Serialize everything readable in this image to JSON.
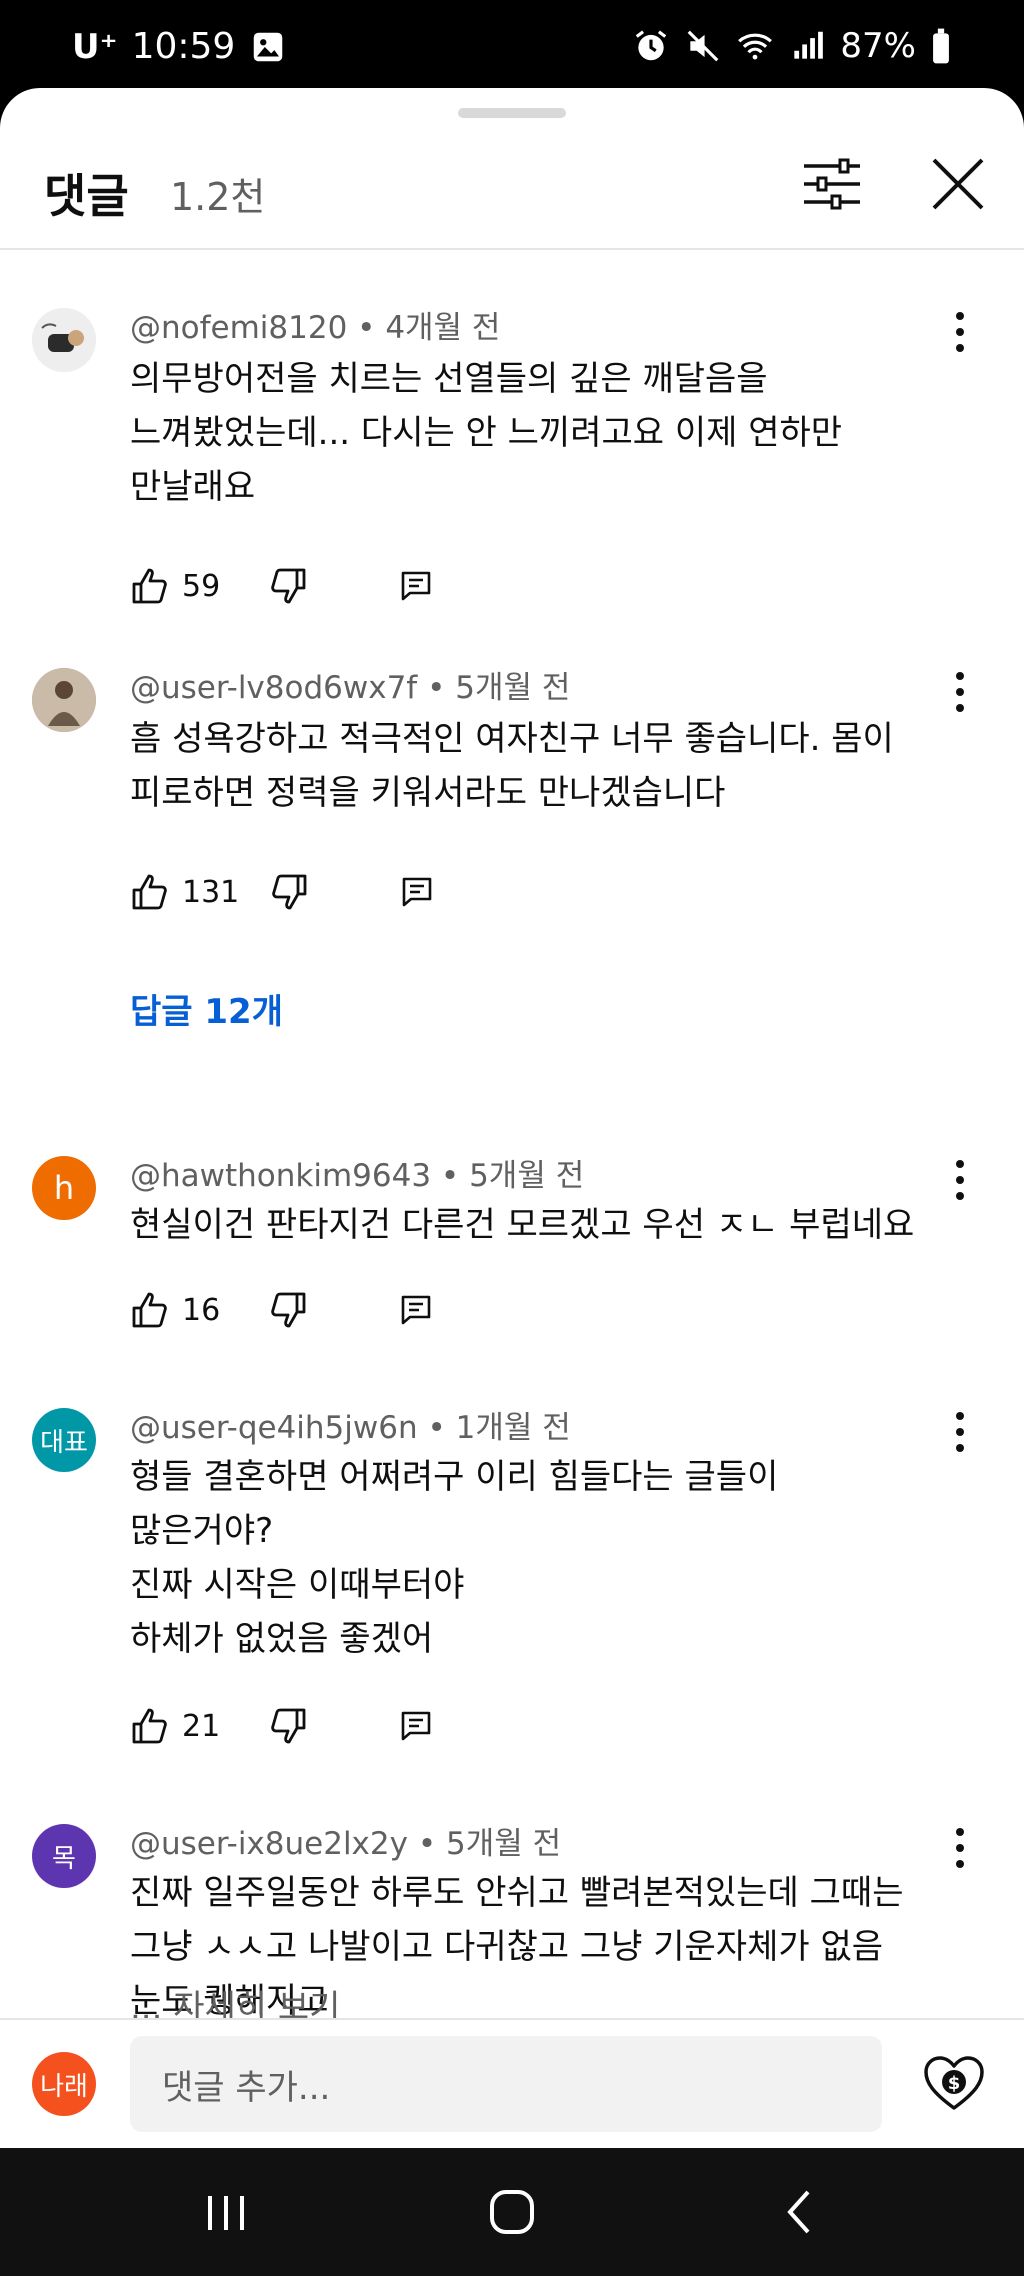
{
  "status_bar": {
    "carrier": "U⁺",
    "time": "10:59",
    "battery": "87%"
  },
  "header": {
    "title": "댓글",
    "count": "1.2천"
  },
  "comments": [
    {
      "author": "@nofemi8120",
      "age": "4개월 전",
      "text": "의무방어전을 치르는 선열들의 깊은 깨달음을\n느껴봤었는데... 다시는 안 느끼려고요 이제 연하만\n만날래요",
      "likes": "59",
      "avatar_color": "#e0e0e0"
    },
    {
      "author": "@user-lv8od6wx7f",
      "age": "5개월 전",
      "text": "흠 성욕강하고 적극적인 여자친구 너무 좋습니다. 몸이\n피로하면 정력을 키워서라도 만나겠습니다",
      "likes": "131",
      "replies": "답글 12개",
      "avatar_color": "#b9a893"
    },
    {
      "author": "@hawthonkim9643",
      "age": "5개월 전",
      "text": "현실이건 판타지건 다른건 모르겠고 우선 ㅈㄴ 부럽네요",
      "likes": "16",
      "avatar_letter": "h",
      "avatar_color": "#ef6c00"
    },
    {
      "author": "@user-qe4ih5jw6n",
      "age": "1개월 전",
      "text": "형들 결혼하면 어쩌려구 이리 힘들다는 글들이\n많은거야?\n진짜 시작은 이때부터야\n하체가 없었음 좋겠어",
      "likes": "21",
      "avatar_letter": "대표",
      "avatar_color": "#0097a7"
    },
    {
      "author": "@user-ix8ue2lx2y",
      "age": "5개월 전",
      "text": "진짜 일주일동안 하루도 안쉬고 빨려본적있는데 그때는\n그냥 ㅅㅅ고 나발이고 다귀찮고 그냥 기운자체가 없음\n눈도 퀭해지고",
      "read_more": "... 자세히 보기",
      "avatar_letter": "목",
      "avatar_color": "#5e35b1"
    }
  ],
  "input": {
    "avatar_letter": "나래",
    "placeholder": "댓글 추가..."
  },
  "icons": {
    "like": "thumbs-up-icon",
    "dislike": "thumbs-down-icon",
    "reply": "reply-icon",
    "more": "more-vert-icon",
    "filter": "sliders-icon",
    "close": "close-icon",
    "thanks": "super-thanks-icon"
  }
}
